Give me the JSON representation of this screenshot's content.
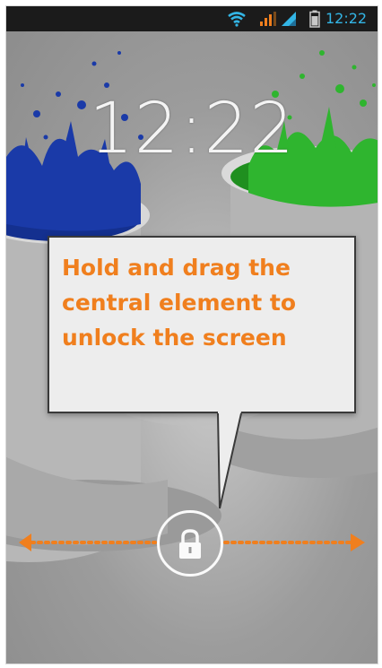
{
  "status_bar": {
    "time": "12:22",
    "icons": [
      "wifi-icon",
      "signal-icon",
      "signal-icon",
      "battery-icon"
    ],
    "accent_color": "#33b5e5",
    "signal_color": "#f07f1e"
  },
  "lockscreen": {
    "clock": "12:22",
    "wallpaper": "paint-splash",
    "splash_colors": [
      "#1a3aa8",
      "#2fb52f"
    ]
  },
  "tooltip": {
    "text": "Hold and drag the\ncentral element to\nunlock the screen",
    "text_color": "#f07f1e"
  },
  "unlock": {
    "handle_icon": "lock-icon",
    "arrow_color": "#f07f1e"
  }
}
